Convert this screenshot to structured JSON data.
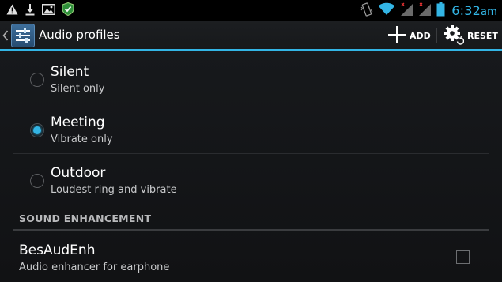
{
  "status_bar": {
    "time": "6:32",
    "ampm": "am",
    "icons": [
      "warning-icon",
      "download-icon",
      "image-icon",
      "shield-icon",
      "vibrate-icon",
      "wifi-icon",
      "signal-1-icon",
      "signal-2-icon",
      "battery-icon"
    ]
  },
  "action_bar": {
    "title": "Audio profiles",
    "add_label": "ADD",
    "reset_label": "RESET"
  },
  "profiles": [
    {
      "title": "Silent",
      "summary": "Silent only",
      "checked": false
    },
    {
      "title": "Meeting",
      "summary": "Vibrate only",
      "checked": true
    },
    {
      "title": "Outdoor",
      "summary": "Loudest ring and vibrate",
      "checked": false
    }
  ],
  "sound_enhancement": {
    "header": "SOUND ENHANCEMENT",
    "title": "BesAudEnh",
    "summary": "Audio enhancer for earphone",
    "checked": false
  },
  "colors": {
    "accent": "#33b5e5",
    "background": "#0e0f11",
    "divider": "#2a2c2f"
  }
}
